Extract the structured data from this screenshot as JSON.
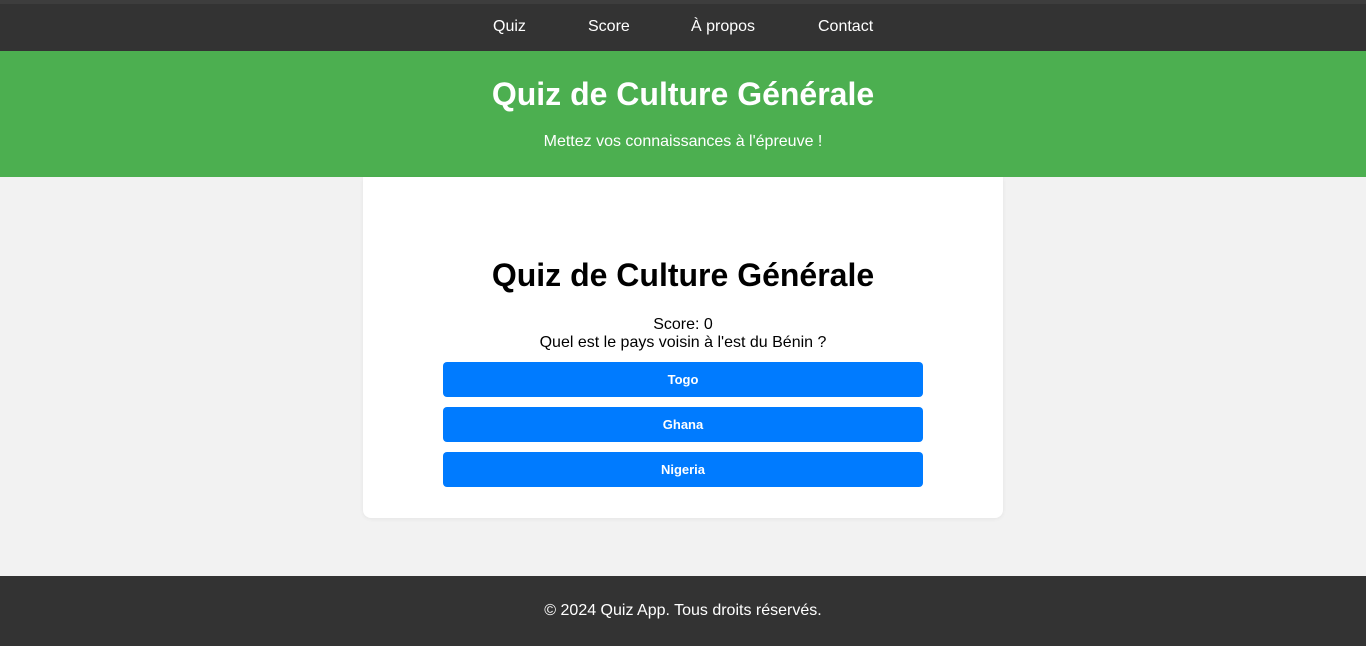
{
  "nav": {
    "items": [
      {
        "label": "Quiz"
      },
      {
        "label": "Score"
      },
      {
        "label": "À propos"
      },
      {
        "label": "Contact"
      }
    ]
  },
  "header": {
    "title": "Quiz de Culture Générale",
    "subtitle": "Mettez vos connaissances à l'épreuve !"
  },
  "quiz": {
    "title": "Quiz de Culture Générale",
    "score_text": "Score: 0",
    "question": "Quel est le pays voisin à l'est du Bénin ?",
    "answers": [
      {
        "label": "Togo"
      },
      {
        "label": "Ghana"
      },
      {
        "label": "Nigeria"
      }
    ]
  },
  "footer": {
    "text": "© 2024 Quiz App. Tous droits réservés."
  },
  "colors": {
    "nav_bg": "#333333",
    "hero_bg": "#4caf50",
    "button_bg": "#007bff",
    "page_bg": "#f2f2f2"
  }
}
